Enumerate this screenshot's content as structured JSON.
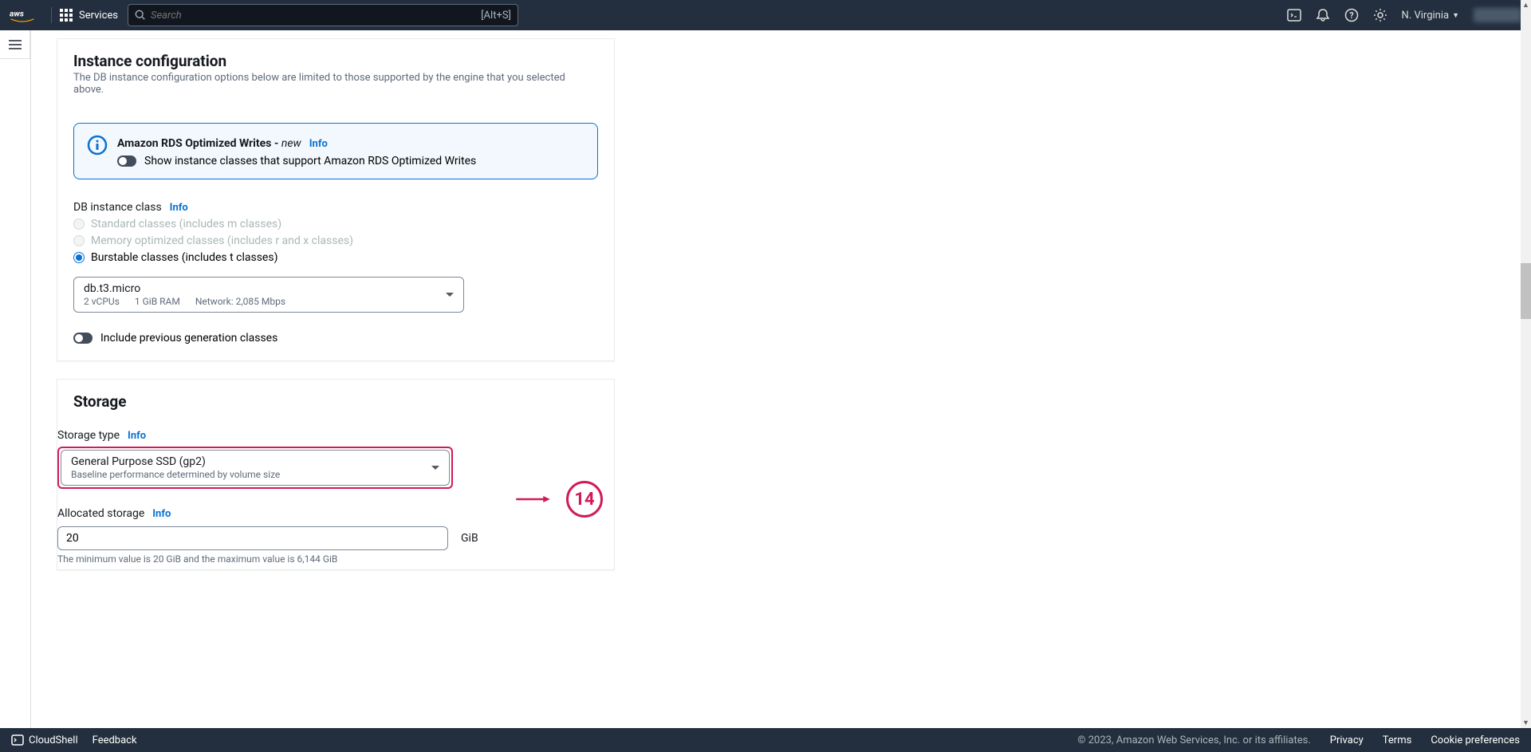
{
  "nav": {
    "services": "Services",
    "search_placeholder": "Search",
    "search_shortcut": "[Alt+S]",
    "region": "N. Virginia"
  },
  "instance_config": {
    "title": "Instance configuration",
    "subtitle": "The DB instance configuration options below are limited to those supported by the engine that you selected above.",
    "optimized_title": "Amazon RDS Optimized Writes - ",
    "optimized_new": "new",
    "info": "Info",
    "optimized_toggle_label": "Show instance classes that support Amazon RDS Optimized Writes",
    "class_label": "DB instance class",
    "radio_standard": "Standard classes (includes m classes)",
    "radio_memory": "Memory optimized classes (includes r and x classes)",
    "radio_burstable": "Burstable classes (includes t classes)",
    "instance_selected": "db.t3.micro",
    "inst_vcpu": "2 vCPUs",
    "inst_ram": "1 GiB RAM",
    "inst_net": "Network: 2,085 Mbps",
    "prev_gen_label": "Include previous generation classes"
  },
  "storage": {
    "title": "Storage",
    "type_label": "Storage type",
    "info": "Info",
    "selected_type": "General Purpose SSD (gp2)",
    "selected_sub": "Baseline performance determined by volume size",
    "allocated_label": "Allocated storage",
    "allocated_value": "20",
    "unit": "GiB",
    "min_max_text": "The minimum value is 20 GiB and the maximum value is 6,144 GiB"
  },
  "annotation": {
    "number": "14"
  },
  "footer": {
    "cloudshell": "CloudShell",
    "feedback": "Feedback",
    "copyright": "© 2023, Amazon Web Services, Inc. or its affiliates.",
    "privacy": "Privacy",
    "terms": "Terms",
    "cookie": "Cookie preferences"
  }
}
